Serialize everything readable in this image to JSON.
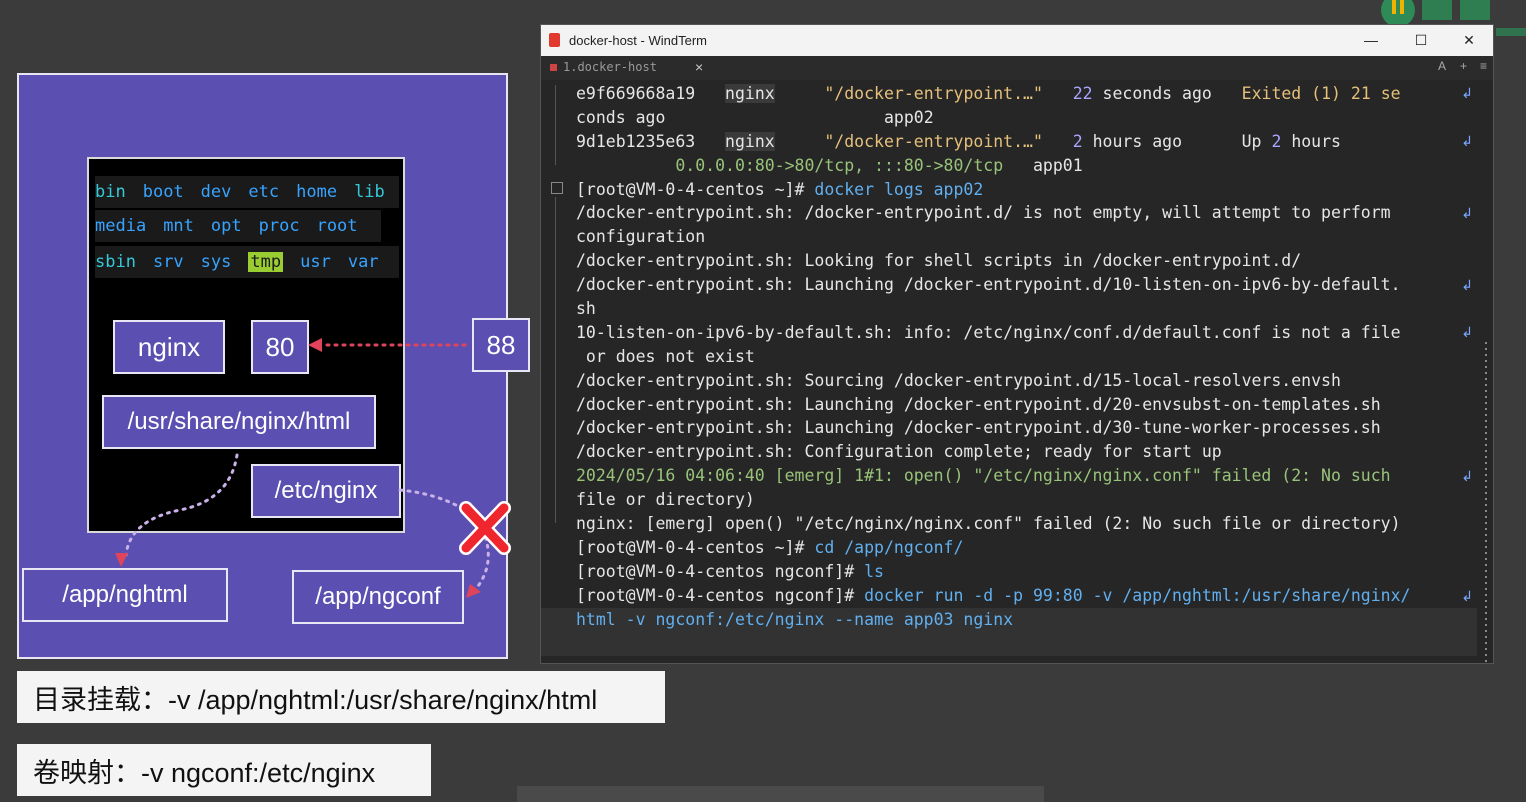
{
  "diagram": {
    "dirs_row1": [
      "bin",
      "boot",
      "dev",
      "etc",
      "home",
      "lib"
    ],
    "dirs_row2": [
      "media",
      "mnt",
      "opt",
      "proc",
      "root"
    ],
    "dirs_row3": [
      "sbin",
      "srv",
      "sys",
      "tmp",
      "usr",
      "var"
    ],
    "nginx_label": "nginx",
    "container_port": "80",
    "host_port": "88",
    "html_path": "/usr/share/nginx/html",
    "etc_path": "/etc/nginx",
    "host_html": "/app/nghtml",
    "host_conf": "/app/ngconf"
  },
  "captions": {
    "mount": "目录挂载：-v /app/nghtml:/usr/share/nginx/html",
    "volume": "卷映射：-v ngconf:/etc/nginx"
  },
  "window": {
    "title": "docker-host - WindTerm",
    "tab": "1.docker-host",
    "tab_close": "×",
    "minimize": "—",
    "maximize": "☐",
    "close": "✕",
    "tab_tools": [
      "A",
      "+",
      "≡"
    ]
  },
  "terminal": {
    "row1_id": "e9f669668a19",
    "row1_image": "nginx",
    "row1_cmd": "\"/docker-entrypoint.…\"",
    "row1_num": "22",
    "row1_created": "seconds ago",
    "row1_status": "Exited (1) 21 se",
    "row1_cont": "conds ago",
    "row1_name": "app02",
    "row2_id": "9d1eb1235e63",
    "row2_image": "nginx",
    "row2_cmd": "\"/docker-entrypoint.…\"",
    "row2_num": "2",
    "row2_created": "hours ago",
    "row2_status_a": "Up",
    "row2_status_n": "2",
    "row2_status_b": "hours",
    "row2_ports": "0.0.0.0:80->80/tcp, :::80->80/tcp",
    "row2_name": "app01",
    "prompt1": "[root@VM-0-4-centos ~]#",
    "cmd1": "docker logs app02",
    "log1": "/docker-entrypoint.sh: /docker-entrypoint.d/ is not empty, will attempt to perform",
    "log1b": "configuration",
    "log2": "/docker-entrypoint.sh: Looking for shell scripts in /docker-entrypoint.d/",
    "log3": "/docker-entrypoint.sh: Launching /docker-entrypoint.d/10-listen-on-ipv6-by-default.",
    "log3b": "sh",
    "log4": "10-listen-on-ipv6-by-default.sh: info: /etc/nginx/conf.d/default.conf is not a file",
    "log4b": " or does not exist",
    "log5": "/docker-entrypoint.sh: Sourcing /docker-entrypoint.d/15-local-resolvers.envsh",
    "log6": "/docker-entrypoint.sh: Launching /docker-entrypoint.d/20-envsubst-on-templates.sh",
    "log7": "/docker-entrypoint.sh: Launching /docker-entrypoint.d/30-tune-worker-processes.sh",
    "log8": "/docker-entrypoint.sh: Configuration complete; ready for start up",
    "log9": "2024/05/16 04:06:40 [emerg] 1#1: open() \"/etc/nginx/nginx.conf\" failed (2: No such",
    "log9b": "file or directory)",
    "log10": "nginx: [emerg] open() \"/etc/nginx/nginx.conf\" failed (2: No such file or directory)",
    "prompt2": "[root@VM-0-4-centos ~]#",
    "cmd2": "cd /app/ngconf/",
    "prompt3": "[root@VM-0-4-centos ngconf]#",
    "cmd3": "ls",
    "prompt4": "[root@VM-0-4-centos ngconf]#",
    "cmd4": "docker run -d -p 99:80 -v /app/nghtml:/usr/share/nginx/",
    "cmd4b": "html -v ngconf:/etc/nginx --name app03 nginx"
  },
  "colors": {
    "diagram_bg": "#5b4fb1",
    "arrow": "#e0445a",
    "dotted_line": "#c9b2e8"
  },
  "icons": [
    "windterm-app-icon",
    "red-x-icon",
    "wrap-arrow-icon"
  ]
}
